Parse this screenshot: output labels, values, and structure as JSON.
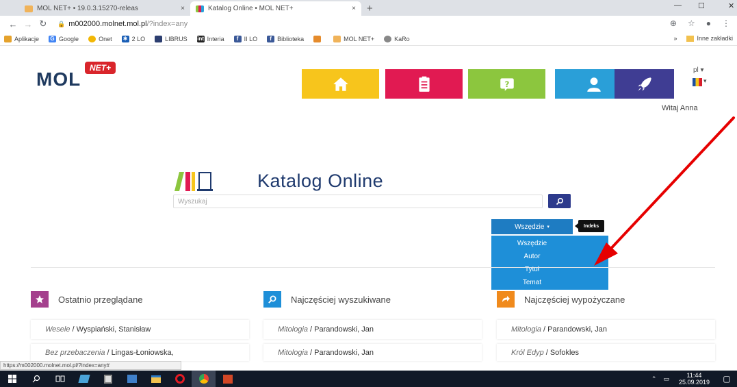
{
  "browser": {
    "tabs": [
      {
        "title": "MOL NET+ • 19.0.3.15270-releas",
        "close": "×"
      },
      {
        "title": "Katalog Online • MOL NET+",
        "close": "×"
      }
    ],
    "new_tab": "+",
    "url_domain": "m002000.molnet.mol.pl",
    "url_path": "/?index=any",
    "bookmarks": [
      {
        "label": "Aplikacje",
        "color": "#e5a22c"
      },
      {
        "label": "Google",
        "color": "#4285f4"
      },
      {
        "label": "Onet",
        "color": "#f2b705"
      },
      {
        "label": "2 LO",
        "color": "#1b5fb6"
      },
      {
        "label": "LIBRUS",
        "color": "#2c3e70"
      },
      {
        "label": "Interia",
        "color": "#222222"
      },
      {
        "label": "II LO",
        "color": "#3b5998"
      },
      {
        "label": "Biblioteka",
        "color": "#3b5998"
      },
      {
        "label": "",
        "color": "#e58b2c"
      },
      {
        "label": "MOL NET+",
        "color": "#f0b35a"
      },
      {
        "label": "KaRo",
        "color": "#888888"
      }
    ],
    "other_bookmarks": "Inne zakładki",
    "status_url": "https://m002000.molnet.mol.pl/?index=any#"
  },
  "site": {
    "logo_text": "MOL",
    "logo_badge": "NET+",
    "nav_colors": [
      "#f7c51c",
      "#e11a52",
      "#8cc63e",
      "#2a9fd8",
      "#3f3d93"
    ],
    "lang": "pl ▾",
    "welcome": "Witaj Anna"
  },
  "catalog": {
    "title": "Katalog Online",
    "search_placeholder": "Wyszukaj",
    "scope_label": "Wszędzie",
    "scope_caret": "▾",
    "tooltip": "Indeks",
    "scope_options": [
      "Wszędzie",
      "Autor",
      "Tytuł",
      "Temat"
    ]
  },
  "sections": [
    {
      "title": "Ostatnio przeglądane",
      "color": "#a4408d",
      "items": [
        {
          "title": "Wesele",
          "author": "Wyspiański, Stanisław"
        },
        {
          "title": "Bez przebaczenia",
          "author": "Lingas-Łoniowska,"
        }
      ]
    },
    {
      "title": "Najczęściej wyszukiwane",
      "color": "#1e8fd8",
      "items": [
        {
          "title": "Mitologia",
          "author": "Parandowski, Jan"
        },
        {
          "title": "Mitologia",
          "author": "Parandowski, Jan"
        }
      ]
    },
    {
      "title": "Najczęściej wypożyczane",
      "color": "#f08a1c",
      "items": [
        {
          "title": "Mitologia",
          "author": "Parandowski, Jan"
        },
        {
          "title": "Król Edyp",
          "author": "Sofokles"
        }
      ]
    }
  ],
  "taskbar": {
    "time": "11:44",
    "date": "25.09.2019"
  }
}
